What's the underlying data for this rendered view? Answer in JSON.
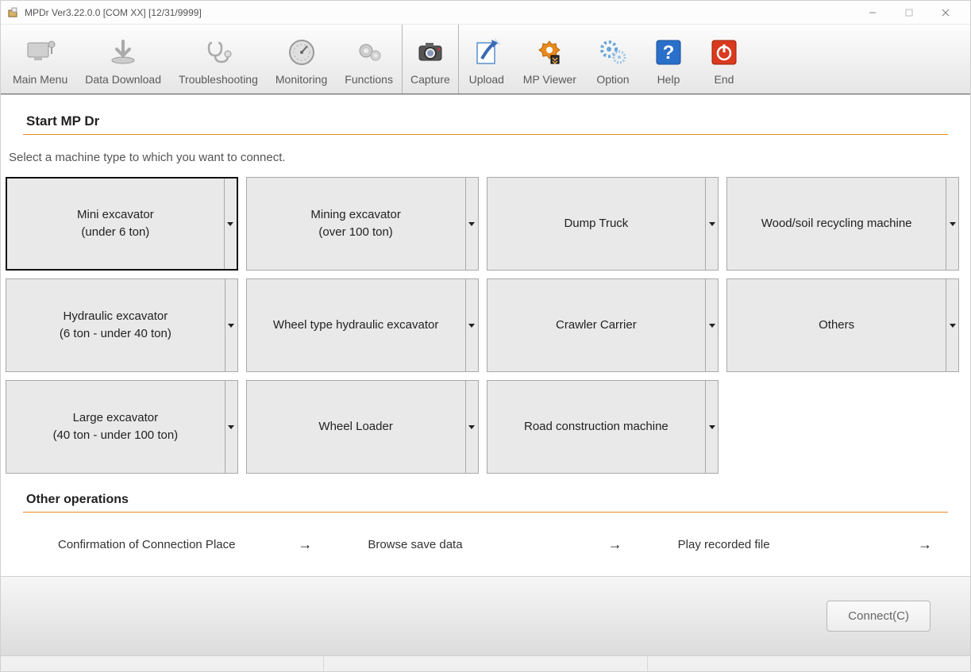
{
  "titlebar": {
    "title": "MPDr Ver3.22.0.0 [COM XX] [12/31/9999]"
  },
  "toolbar": {
    "items": [
      {
        "id": "main-menu",
        "label": "Main Menu",
        "icon": "monitor-gray"
      },
      {
        "id": "data-download",
        "label": "Data Download",
        "icon": "download-gray"
      },
      {
        "id": "troubleshooting",
        "label": "Troubleshooting",
        "icon": "stethoscope-gray"
      },
      {
        "id": "monitoring",
        "label": "Monitoring",
        "icon": "gauge-gray"
      },
      {
        "id": "functions",
        "label": "Functions",
        "icon": "gear-gray"
      },
      {
        "id": "capture",
        "label": "Capture",
        "icon": "camera"
      },
      {
        "id": "upload",
        "label": "Upload",
        "icon": "upload-blue"
      },
      {
        "id": "mp-viewer",
        "label": "MP Viewer",
        "icon": "gear-orange"
      },
      {
        "id": "option",
        "label": "Option",
        "icon": "gears-blue"
      },
      {
        "id": "help",
        "label": "Help",
        "icon": "question-blue"
      },
      {
        "id": "end",
        "label": "End",
        "icon": "power-red"
      }
    ]
  },
  "main": {
    "section_title": "Start MP Dr",
    "instruction": "Select a machine type to which you want to connect.",
    "machines": [
      {
        "line1": "Mini excavator",
        "line2": "(under 6 ton)",
        "selected": true,
        "has_dropdown": true
      },
      {
        "line1": "Mining excavator",
        "line2": "(over 100 ton)",
        "selected": false,
        "has_dropdown": true
      },
      {
        "line1": "Dump Truck",
        "line2": "",
        "selected": false,
        "has_dropdown": true
      },
      {
        "line1": "Wood/soil recycling machine",
        "line2": "",
        "selected": false,
        "has_dropdown": true
      },
      {
        "line1": "Hydraulic excavator",
        "line2": "(6 ton - under 40 ton)",
        "selected": false,
        "has_dropdown": true
      },
      {
        "line1": "Wheel type hydraulic excavator",
        "line2": "",
        "selected": false,
        "has_dropdown": true
      },
      {
        "line1": "Crawler Carrier",
        "line2": "",
        "selected": false,
        "has_dropdown": true
      },
      {
        "line1": "Others",
        "line2": "",
        "selected": false,
        "has_dropdown": true
      },
      {
        "line1": "Large excavator",
        "line2": "(40 ton - under 100 ton)",
        "selected": false,
        "has_dropdown": true
      },
      {
        "line1": "Wheel Loader",
        "line2": "",
        "selected": false,
        "has_dropdown": true
      },
      {
        "line1": "Road construction machine",
        "line2": "",
        "selected": false,
        "has_dropdown": true
      }
    ],
    "other_title": "Other operations",
    "other_items": [
      {
        "label": "Confirmation of Connection Place"
      },
      {
        "label": "Browse save data"
      },
      {
        "label": "Play recorded file"
      }
    ]
  },
  "footer": {
    "connect_label": "Connect(C)"
  }
}
